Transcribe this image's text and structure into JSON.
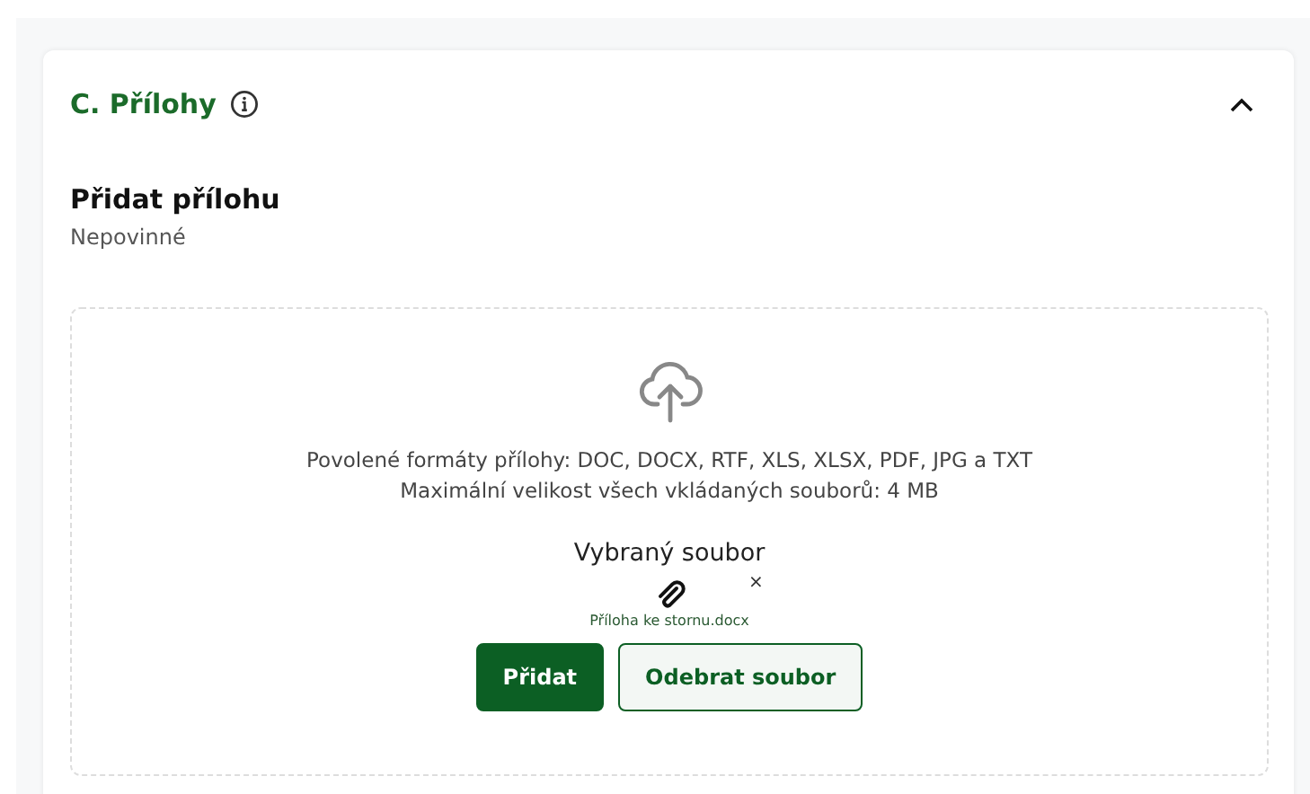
{
  "section": {
    "title": "C. Přílohy",
    "expanded": true
  },
  "field": {
    "label": "Přidat přílohu",
    "hint": "Nepovinné"
  },
  "dropzone": {
    "formats": "Povolené formáty přílohy: DOC, DOCX, RTF, XLS, XLSX, PDF, JPG a TXT",
    "max_size": "Maximální velikost všech vkládaných souborů: 4 MB",
    "selected_heading": "Vybraný soubor",
    "file": {
      "name": "Příloha ke stornu.docx",
      "remove": "×"
    }
  },
  "buttons": [
    {
      "label": "Přidat",
      "kind": "primary"
    },
    {
      "label": "Odebrat soubor",
      "kind": "secondary"
    }
  ]
}
